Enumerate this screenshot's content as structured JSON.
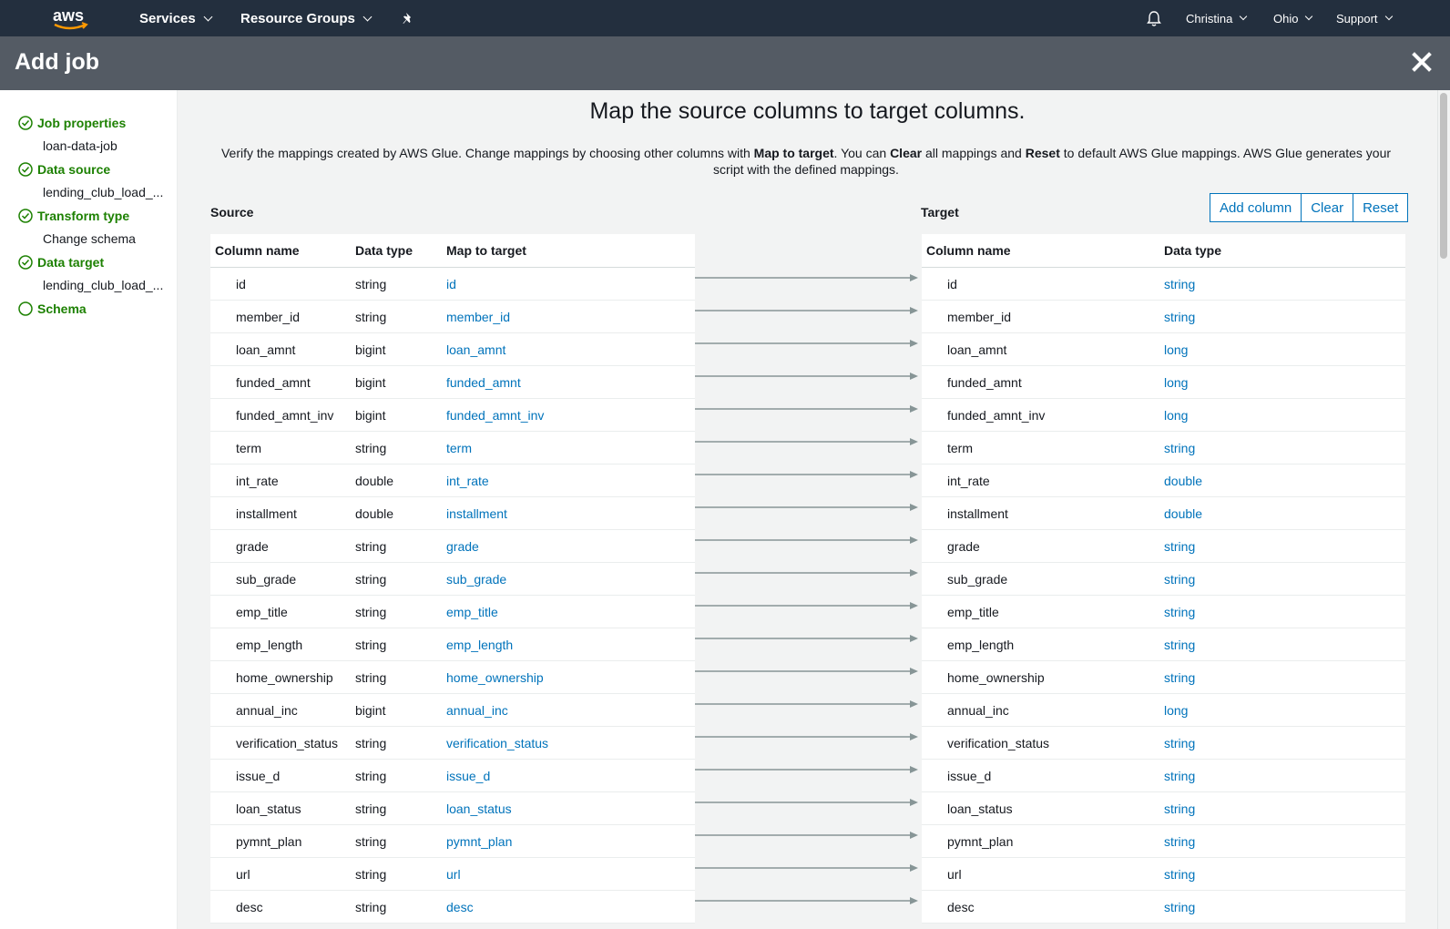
{
  "topnav": {
    "services": "Services",
    "resource_groups": "Resource Groups",
    "pin_icon": "pin-icon",
    "bell_icon": "bell-icon",
    "user": "Christina",
    "region": "Ohio",
    "support": "Support"
  },
  "header": {
    "title": "Add job"
  },
  "sidebar": {
    "steps": [
      {
        "label": "Job properties",
        "sub": "loan-data-job",
        "status": "done"
      },
      {
        "label": "Data source",
        "sub": "lending_club_load_...",
        "status": "done"
      },
      {
        "label": "Transform type",
        "sub": "Change schema",
        "status": "done"
      },
      {
        "label": "Data target",
        "sub": "lending_club_load_...",
        "status": "done"
      },
      {
        "label": "Schema",
        "sub": "",
        "status": "current"
      }
    ]
  },
  "main": {
    "title": "Map the source columns to target columns.",
    "desc": {
      "p1": "Verify the mappings created by AWS Glue. Change mappings by choosing other columns with ",
      "b1": "Map to target",
      "p2": ". You can ",
      "b2": "Clear",
      "p3": " all mappings and ",
      "b3": "Reset",
      "p4": " to default AWS Glue mappings. AWS Glue generates your script with the defined mappings."
    },
    "source_label": "Source",
    "target_label": "Target",
    "buttons": {
      "add_column": "Add column",
      "clear": "Clear",
      "reset": "Reset"
    },
    "source_headers": {
      "col": "Column name",
      "type": "Data type",
      "map": "Map to target"
    },
    "target_headers": {
      "col": "Column name",
      "type": "Data type"
    },
    "rows": [
      {
        "src": "id",
        "src_type": "string",
        "map": "id",
        "tgt": "id",
        "tgt_type": "string"
      },
      {
        "src": "member_id",
        "src_type": "string",
        "map": "member_id",
        "tgt": "member_id",
        "tgt_type": "string"
      },
      {
        "src": "loan_amnt",
        "src_type": "bigint",
        "map": "loan_amnt",
        "tgt": "loan_amnt",
        "tgt_type": "long"
      },
      {
        "src": "funded_amnt",
        "src_type": "bigint",
        "map": "funded_amnt",
        "tgt": "funded_amnt",
        "tgt_type": "long"
      },
      {
        "src": "funded_amnt_inv",
        "src_type": "bigint",
        "map": "funded_amnt_inv",
        "tgt": "funded_amnt_inv",
        "tgt_type": "long"
      },
      {
        "src": "term",
        "src_type": "string",
        "map": "term",
        "tgt": "term",
        "tgt_type": "string"
      },
      {
        "src": "int_rate",
        "src_type": "double",
        "map": "int_rate",
        "tgt": "int_rate",
        "tgt_type": "double"
      },
      {
        "src": "installment",
        "src_type": "double",
        "map": "installment",
        "tgt": "installment",
        "tgt_type": "double"
      },
      {
        "src": "grade",
        "src_type": "string",
        "map": "grade",
        "tgt": "grade",
        "tgt_type": "string"
      },
      {
        "src": "sub_grade",
        "src_type": "string",
        "map": "sub_grade",
        "tgt": "sub_grade",
        "tgt_type": "string"
      },
      {
        "src": "emp_title",
        "src_type": "string",
        "map": "emp_title",
        "tgt": "emp_title",
        "tgt_type": "string"
      },
      {
        "src": "emp_length",
        "src_type": "string",
        "map": "emp_length",
        "tgt": "emp_length",
        "tgt_type": "string"
      },
      {
        "src": "home_ownership",
        "src_type": "string",
        "map": "home_ownership",
        "tgt": "home_ownership",
        "tgt_type": "string"
      },
      {
        "src": "annual_inc",
        "src_type": "bigint",
        "map": "annual_inc",
        "tgt": "annual_inc",
        "tgt_type": "long"
      },
      {
        "src": "verification_status",
        "src_type": "string",
        "map": "verification_status",
        "tgt": "verification_status",
        "tgt_type": "string"
      },
      {
        "src": "issue_d",
        "src_type": "string",
        "map": "issue_d",
        "tgt": "issue_d",
        "tgt_type": "string"
      },
      {
        "src": "loan_status",
        "src_type": "string",
        "map": "loan_status",
        "tgt": "loan_status",
        "tgt_type": "string"
      },
      {
        "src": "pymnt_plan",
        "src_type": "string",
        "map": "pymnt_plan",
        "tgt": "pymnt_plan",
        "tgt_type": "string"
      },
      {
        "src": "url",
        "src_type": "string",
        "map": "url",
        "tgt": "url",
        "tgt_type": "string"
      },
      {
        "src": "desc",
        "src_type": "string",
        "map": "desc",
        "tgt": "desc",
        "tgt_type": "string"
      }
    ]
  },
  "colors": {
    "nav_bg": "#232f3e",
    "header_bg": "#545b64",
    "link": "#0073bb",
    "success": "#1d8102"
  }
}
